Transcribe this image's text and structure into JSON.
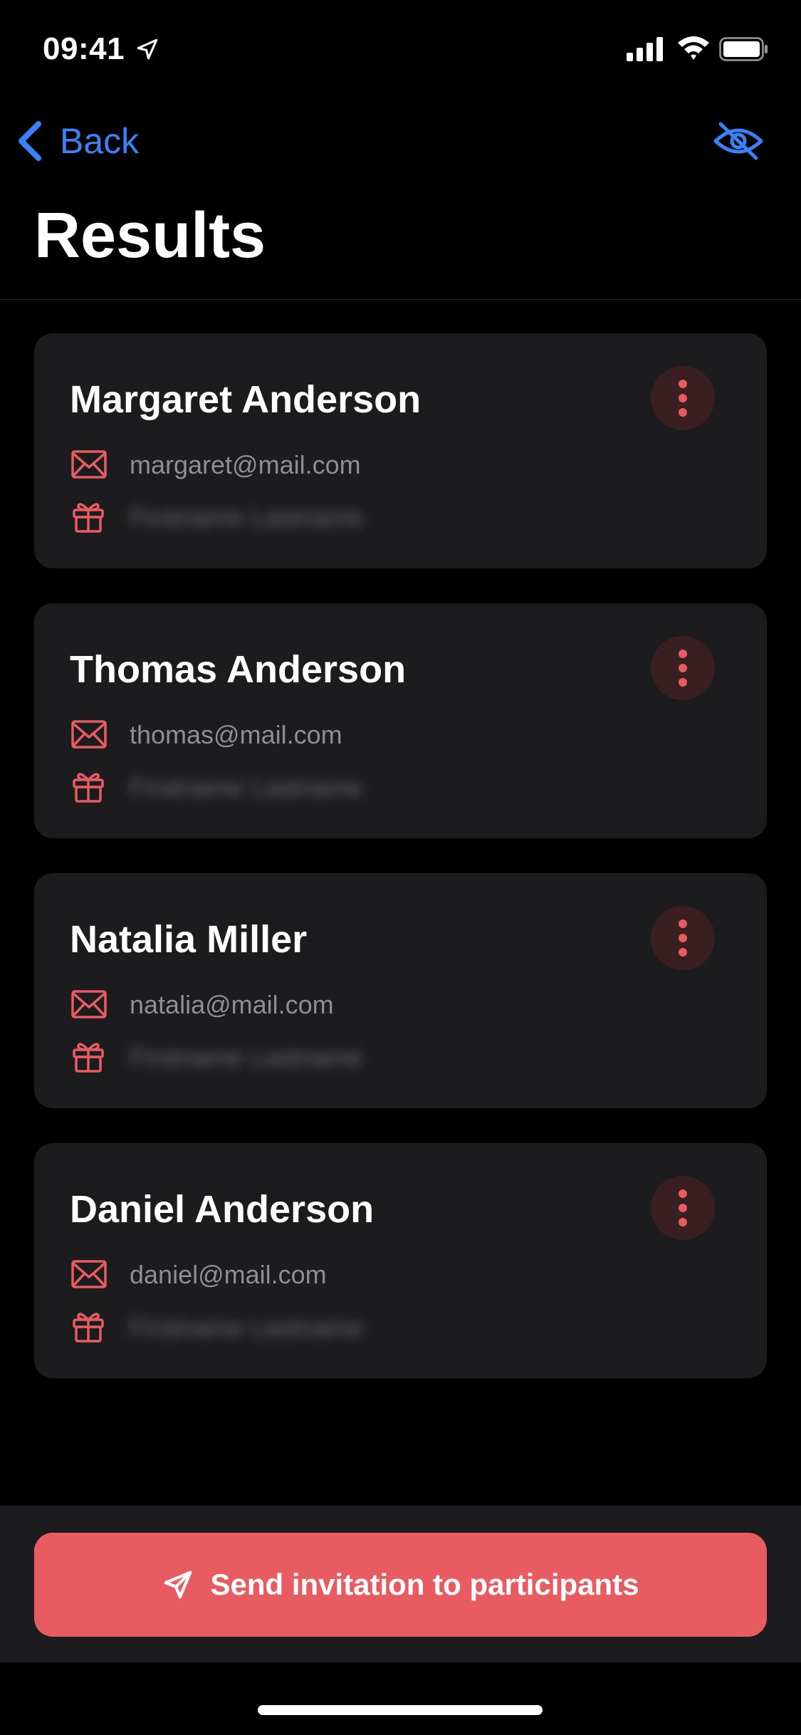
{
  "status_bar": {
    "time": "09:41"
  },
  "nav": {
    "back_label": "Back",
    "title": "Results"
  },
  "participants": [
    {
      "name": "Margaret Anderson",
      "email": "margaret@mail.com",
      "gift_to": "Firstname Lastname"
    },
    {
      "name": "Thomas Anderson",
      "email": "thomas@mail.com",
      "gift_to": "Firstname Lastname"
    },
    {
      "name": "Natalia Miller",
      "email": "natalia@mail.com",
      "gift_to": "Firstname Lastname"
    },
    {
      "name": "Daniel Anderson",
      "email": "daniel@mail.com",
      "gift_to": "Firstname Lastname"
    }
  ],
  "cta": {
    "label": "Send invitation to participants"
  },
  "colors": {
    "accent_blue": "#3a82f7",
    "accent_red": "#e85c61",
    "card_bg": "#1c1c1e"
  },
  "icons": {
    "nav": [
      "chevron-left-icon",
      "eye-slash-icon"
    ],
    "card": [
      "more-vertical-icon",
      "mail-icon",
      "gift-icon"
    ],
    "cta": "paper-plane-icon"
  }
}
